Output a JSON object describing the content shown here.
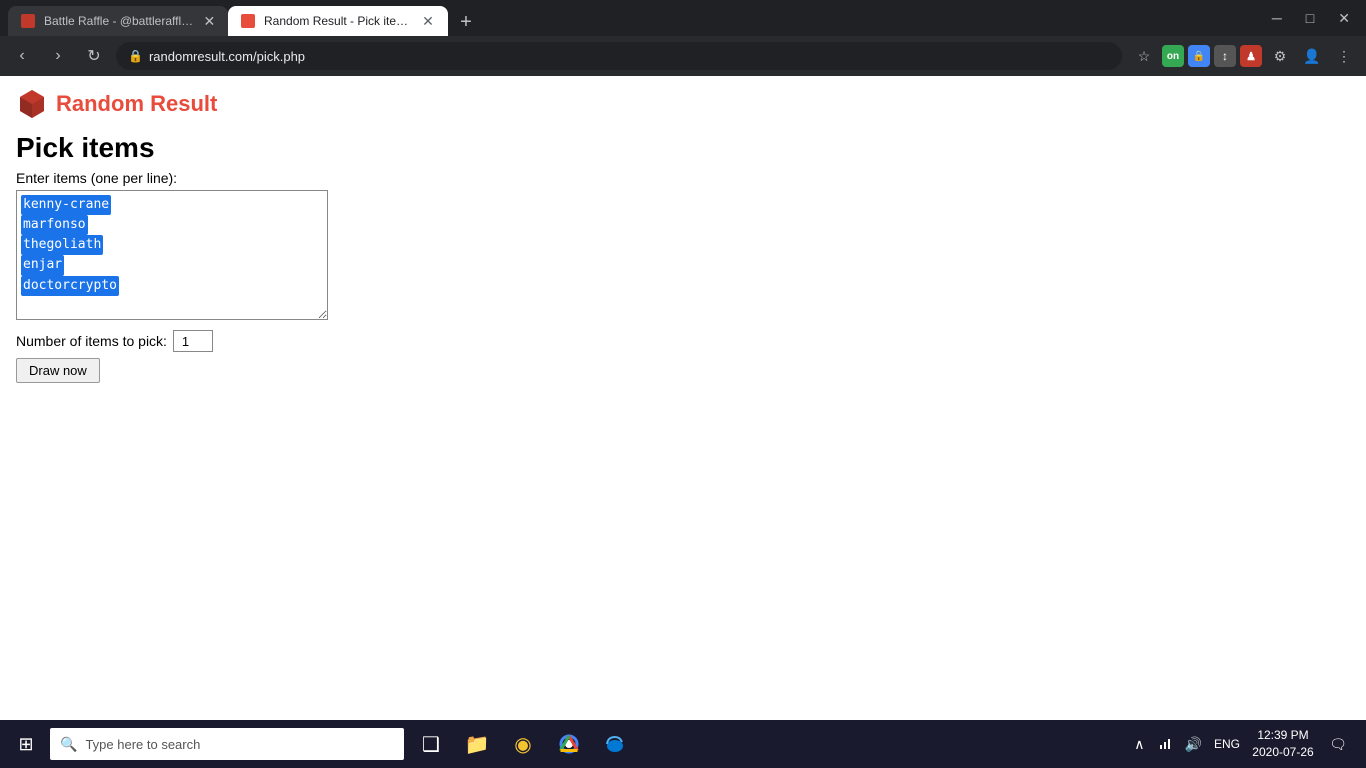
{
  "browser": {
    "tabs": [
      {
        "id": "tab1",
        "label": "Battle Raffle - @battleraffle | Pe…",
        "active": false,
        "favicon": "battle"
      },
      {
        "id": "tab2",
        "label": "Random Result - Pick items",
        "active": true,
        "favicon": "rr"
      }
    ],
    "new_tab_label": "+",
    "window_controls": {
      "minimize": "─",
      "maximize": "□",
      "close": "✕"
    },
    "nav": {
      "back": "‹",
      "forward": "›",
      "reload": "↻"
    },
    "address": "randomresult.com/pick.php",
    "star_icon": "☆",
    "extensions": [
      "on",
      "🔒",
      "↕",
      "♟",
      "⚙"
    ],
    "profile": "👤",
    "menu": "⋮"
  },
  "page": {
    "logo_text": "Random Result",
    "title": "Pick items",
    "items_label": "Enter items (one per line):",
    "textarea_lines": [
      {
        "text": "kenny-crane",
        "selected": true
      },
      {
        "text": "marfonso",
        "selected": true
      },
      {
        "text": "thegoliath",
        "selected": true
      },
      {
        "text": "enjar",
        "selected": true
      },
      {
        "text": "doctorcrypto",
        "selected": true
      }
    ],
    "number_label": "Number of items to pick:",
    "number_value": "1",
    "draw_button": "Draw now"
  },
  "taskbar": {
    "start_icon": "⊞",
    "search_placeholder": "Type here to search",
    "search_icon": "🔍",
    "center_icons": [
      {
        "name": "task-view",
        "icon": "❑"
      },
      {
        "name": "file-explorer",
        "icon": "📁"
      },
      {
        "name": "app1",
        "icon": "🟡"
      },
      {
        "name": "chrome",
        "icon": "●"
      },
      {
        "name": "edge",
        "icon": "◑"
      }
    ],
    "tray": {
      "chevron": "∧",
      "network_icon": "🌐",
      "volume_icon": "🔊",
      "lang": "ENG",
      "time": "12:39 PM",
      "date": "2020-07-26"
    }
  }
}
